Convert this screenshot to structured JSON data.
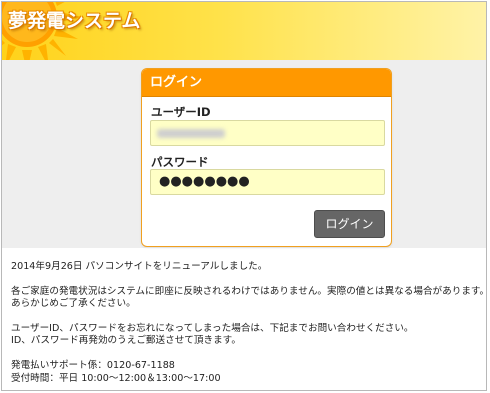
{
  "header": {
    "logo_text": "夢発電システム",
    "colors": {
      "header_yellow": "#ffd21a",
      "sun_orange": "#ff9800"
    }
  },
  "login": {
    "title": "ログイン",
    "user_id_label": "ユーザーID",
    "user_id_value": "",
    "password_label": "パスワード",
    "password_mask": "●●●●●●●●",
    "submit_label": "ログイン",
    "colors": {
      "title_bar": "#ff9800",
      "input_bg": "#ffffc6",
      "button_bg": "#666666"
    }
  },
  "notice": {
    "line1": "2014年9月26日 パソコンサイトをリニューアルしました。",
    "line2": "各ご家庭の発電状況はシステムに即座に反映されるわけではありません。実際の値とは異なる場合があります。",
    "line3": "あらかじめご了承ください。",
    "line4": "ユーザーID、パスワードをお忘れになってしまった場合は、下記までお問い合わせください。",
    "line5": "ID、パスワード再発効のうえご郵送させて頂きます。",
    "line6": "発電払いサポート係：0120-67-1188",
    "line7": "受付時間：平日 10:00～12:00＆13:00～17:00"
  }
}
